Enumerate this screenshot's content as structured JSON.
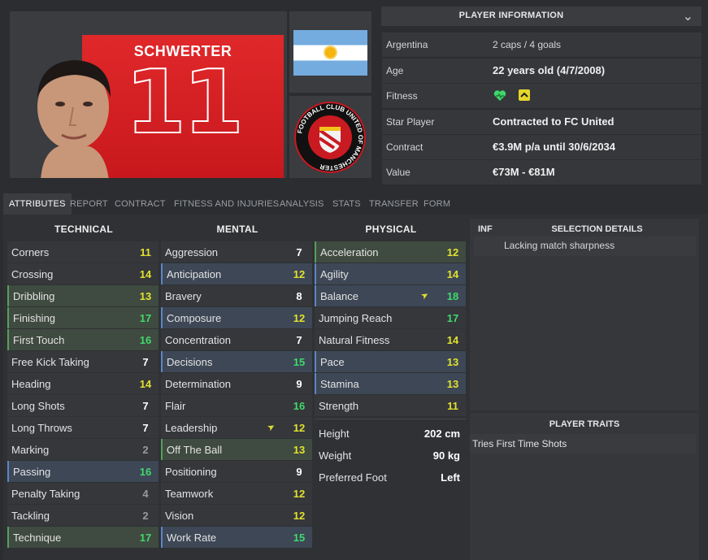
{
  "player": {
    "shirt_name": "SCHWERTER",
    "shirt_number": "11"
  },
  "info": {
    "header": "PLAYER INFORMATION",
    "rows": [
      {
        "label": "Argentina",
        "value": "2 caps / 4 goals"
      },
      {
        "label": "Age",
        "value": "22 years old (4/7/2008)"
      },
      {
        "label": "Fitness",
        "value": ""
      },
      {
        "label": "Star Player",
        "value": "Contracted to FC United"
      },
      {
        "label": "Contract",
        "value": "€3.9M p/a until 30/6/2034"
      },
      {
        "label": "Value",
        "value": "€73M - €81M"
      }
    ]
  },
  "club_crest_text": "FOOTBALL CLUB UNITED OF MANCHESTER",
  "tabs": [
    "ATTRIBUTES",
    "REPORT",
    "CONTRACT",
    "FITNESS AND INJURIES",
    "ANALYSIS",
    "STATS",
    "TRANSFER",
    "FORM"
  ],
  "attributes": {
    "technical_title": "TECHNICAL",
    "mental_title": "MENTAL",
    "physical_title": "PHYSICAL",
    "technical": [
      {
        "name": "Corners",
        "value": "11",
        "color": "#e2e12f",
        "hl": ""
      },
      {
        "name": "Crossing",
        "value": "14",
        "color": "#e2e12f",
        "hl": ""
      },
      {
        "name": "Dribbling",
        "value": "13",
        "color": "#e2e12f",
        "hl": "green"
      },
      {
        "name": "Finishing",
        "value": "17",
        "color": "#42d86c",
        "hl": "green"
      },
      {
        "name": "First Touch",
        "value": "16",
        "color": "#42d86c",
        "hl": "green"
      },
      {
        "name": "Free Kick Taking",
        "value": "7",
        "color": "#ffffff",
        "hl": ""
      },
      {
        "name": "Heading",
        "value": "14",
        "color": "#e2e12f",
        "hl": ""
      },
      {
        "name": "Long Shots",
        "value": "7",
        "color": "#ffffff",
        "hl": ""
      },
      {
        "name": "Long Throws",
        "value": "7",
        "color": "#ffffff",
        "hl": ""
      },
      {
        "name": "Marking",
        "value": "2",
        "color": "#9a9a9a",
        "hl": ""
      },
      {
        "name": "Passing",
        "value": "16",
        "color": "#42d86c",
        "hl": "blue"
      },
      {
        "name": "Penalty Taking",
        "value": "4",
        "color": "#9a9a9a",
        "hl": ""
      },
      {
        "name": "Tackling",
        "value": "2",
        "color": "#9a9a9a",
        "hl": ""
      },
      {
        "name": "Technique",
        "value": "17",
        "color": "#42d86c",
        "hl": "green"
      }
    ],
    "mental": [
      {
        "name": "Aggression",
        "value": "7",
        "color": "#ffffff",
        "hl": ""
      },
      {
        "name": "Anticipation",
        "value": "12",
        "color": "#e2e12f",
        "hl": "blue"
      },
      {
        "name": "Bravery",
        "value": "8",
        "color": "#ffffff",
        "hl": ""
      },
      {
        "name": "Composure",
        "value": "12",
        "color": "#e2e12f",
        "hl": "blue"
      },
      {
        "name": "Concentration",
        "value": "7",
        "color": "#ffffff",
        "hl": ""
      },
      {
        "name": "Decisions",
        "value": "15",
        "color": "#42d86c",
        "hl": "blue"
      },
      {
        "name": "Determination",
        "value": "9",
        "color": "#ffffff",
        "hl": ""
      },
      {
        "name": "Flair",
        "value": "16",
        "color": "#42d86c",
        "hl": ""
      },
      {
        "name": "Leadership",
        "value": "12",
        "color": "#e2e12f",
        "hl": "",
        "arrow": true
      },
      {
        "name": "Off The Ball",
        "value": "13",
        "color": "#e2e12f",
        "hl": "green"
      },
      {
        "name": "Positioning",
        "value": "9",
        "color": "#ffffff",
        "hl": ""
      },
      {
        "name": "Teamwork",
        "value": "12",
        "color": "#e2e12f",
        "hl": ""
      },
      {
        "name": "Vision",
        "value": "12",
        "color": "#e2e12f",
        "hl": ""
      },
      {
        "name": "Work Rate",
        "value": "15",
        "color": "#42d86c",
        "hl": "blue"
      }
    ],
    "physical": [
      {
        "name": "Acceleration",
        "value": "12",
        "color": "#e2e12f",
        "hl": "green"
      },
      {
        "name": "Agility",
        "value": "14",
        "color": "#e2e12f",
        "hl": "blue"
      },
      {
        "name": "Balance",
        "value": "18",
        "color": "#42d86c",
        "hl": "blue",
        "arrow": true
      },
      {
        "name": "Jumping Reach",
        "value": "17",
        "color": "#42d86c",
        "hl": ""
      },
      {
        "name": "Natural Fitness",
        "value": "14",
        "color": "#e2e12f",
        "hl": ""
      },
      {
        "name": "Pace",
        "value": "13",
        "color": "#e2e12f",
        "hl": "blue"
      },
      {
        "name": "Stamina",
        "value": "13",
        "color": "#e2e12f",
        "hl": "blue"
      },
      {
        "name": "Strength",
        "value": "11",
        "color": "#e2e12f",
        "hl": ""
      }
    ],
    "physical_extra": [
      {
        "label": "Height",
        "value": "202 cm"
      },
      {
        "label": "Weight",
        "value": "90 kg"
      },
      {
        "label": "Preferred Foot",
        "value": "Left"
      }
    ]
  },
  "selection": {
    "inf_label": "INF",
    "title": "SELECTION DETAILS",
    "item": "Lacking match sharpness"
  },
  "traits": {
    "title": "PLAYER TRAITS",
    "items": [
      "Tries First Time Shots"
    ]
  },
  "icons": {
    "fitness": "heart-icon",
    "sharpness": "chevron-up-icon",
    "expand": "chevron-down-icon",
    "attribute_trend": "arrow-up-right-icon"
  }
}
